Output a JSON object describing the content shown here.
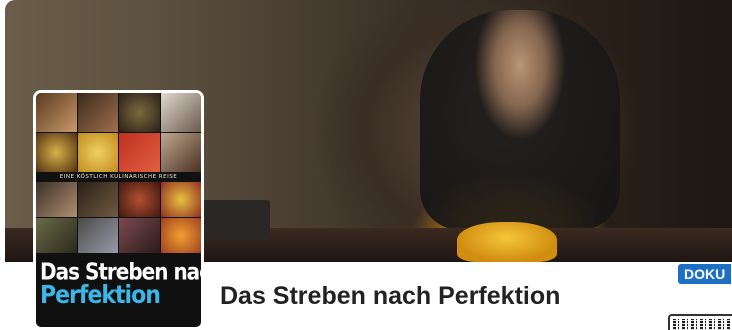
{
  "header": {
    "title": "Das Streben nach Perfektion",
    "genre_badge": "DOKU"
  },
  "poster": {
    "tagline": "EINE KÖSTLICH KULINARISCHE REISE",
    "title_line1": "Das Streben nach",
    "title_line2": "Perfektion"
  },
  "colors": {
    "badge_bg": "#1d6fc4",
    "title_text": "#222222",
    "poster_title_accent": "#3ab6e8"
  },
  "icons": {
    "qr": "qr-code-icon"
  }
}
